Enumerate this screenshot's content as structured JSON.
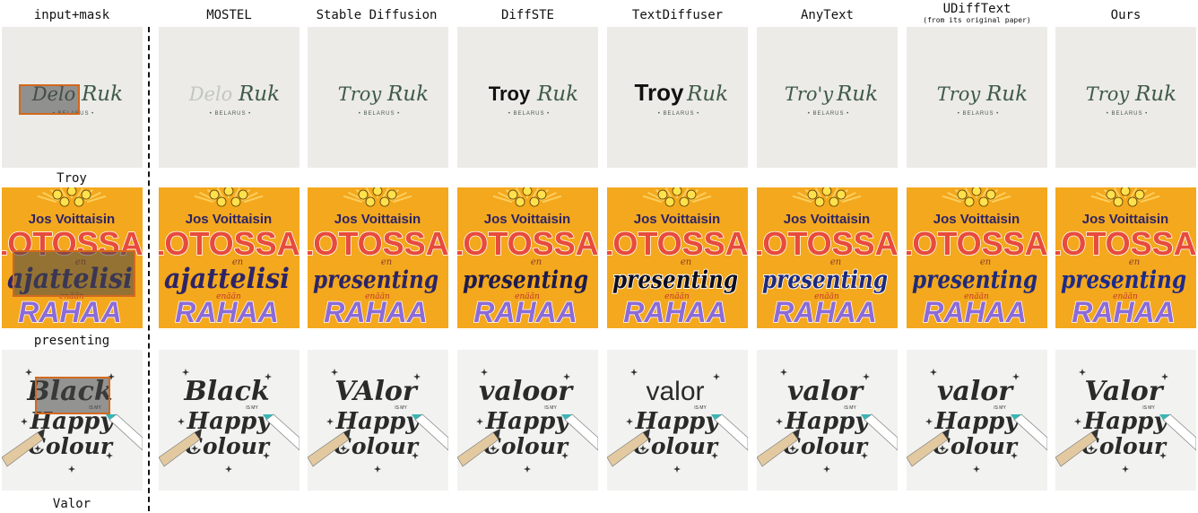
{
  "column_headers": [
    {
      "label": "input+mask",
      "sub": ""
    },
    {
      "label": "MOSTEL",
      "sub": ""
    },
    {
      "label": "Stable Diffusion",
      "sub": ""
    },
    {
      "label": "DiffSTE",
      "sub": ""
    },
    {
      "label": "TextDiffuser",
      "sub": ""
    },
    {
      "label": "AnyText",
      "sub": ""
    },
    {
      "label": "UDiffText",
      "sub": "(from its original paper)"
    },
    {
      "label": "Ours",
      "sub": ""
    }
  ],
  "rows": [
    {
      "target": "Troy",
      "source_word": "Delo",
      "second_word": "Ruk",
      "caption": "• BELARUS •",
      "generated": [
        "Delo",
        "Troy",
        "Troy",
        "Troy",
        "Tro'y",
        "Troy",
        "Troy"
      ]
    },
    {
      "target": "presenting",
      "top_line": "Jos Voittaisin",
      "big_line": "LOTOSSA,",
      "small_line": "en",
      "source_word": "ajattelisi",
      "tiny_line": "enään",
      "bottom_line": "RAHAA",
      "generated": [
        "ajattelisi",
        "presenting",
        "presenting",
        "presenting",
        "presenting",
        "presenting",
        "presenting"
      ]
    },
    {
      "target": "Valor",
      "source_word": "Black",
      "line_small": "IS MY",
      "line2": "Happy",
      "line3": "Colour",
      "generated": [
        "Black",
        "VAlor",
        "valoor",
        "valor",
        "valor",
        "valor",
        "Valor"
      ]
    }
  ]
}
